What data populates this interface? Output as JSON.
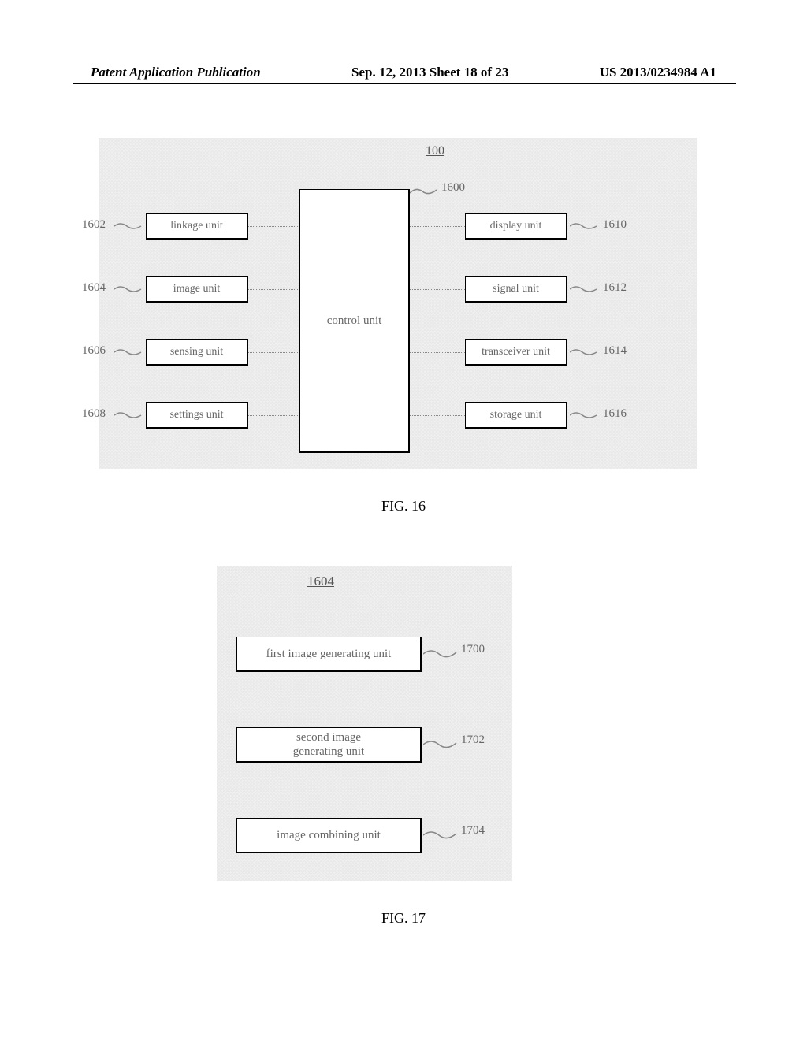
{
  "header": {
    "left": "Patent Application Publication",
    "center": "Sep. 12, 2013  Sheet 18 of 23",
    "right": "US 2013/0234984 A1"
  },
  "fig16": {
    "caption": "FIG. 16",
    "ref_main": "100",
    "control_unit": "control unit",
    "control_unit_ref": "1600",
    "left_blocks": [
      {
        "label": "linkage unit",
        "ref": "1602"
      },
      {
        "label": "image unit",
        "ref": "1604"
      },
      {
        "label": "sensing unit",
        "ref": "1606"
      },
      {
        "label": "settings unit",
        "ref": "1608"
      }
    ],
    "right_blocks": [
      {
        "label": "display unit",
        "ref": "1610"
      },
      {
        "label": "signal unit",
        "ref": "1612"
      },
      {
        "label": "transceiver unit",
        "ref": "1614"
      },
      {
        "label": "storage unit",
        "ref": "1616"
      }
    ]
  },
  "fig17": {
    "caption": "FIG. 17",
    "ref_main": "1604",
    "blocks": [
      {
        "label": "first image generating unit",
        "ref": "1700"
      },
      {
        "label": "second image\ngenerating unit",
        "ref": "1702"
      },
      {
        "label": "image combining unit",
        "ref": "1704"
      }
    ]
  }
}
